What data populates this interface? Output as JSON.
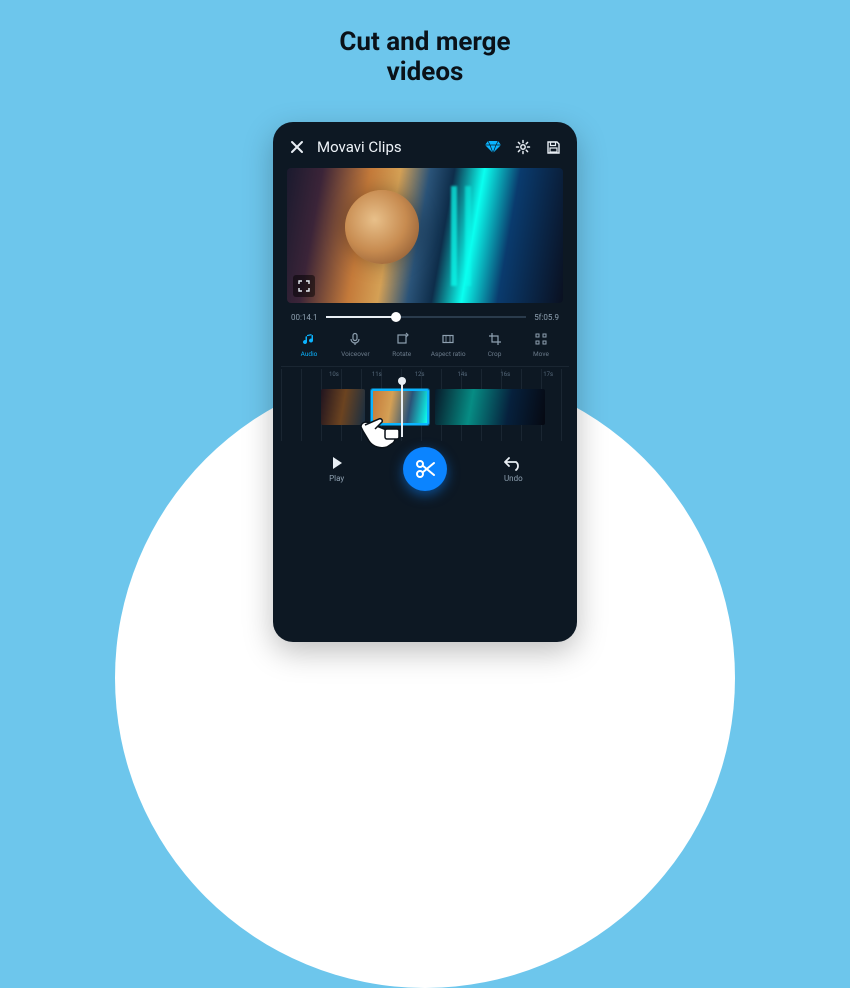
{
  "headline_line1": "Cut and merge",
  "headline_line2": "videos",
  "appbar": {
    "title": "Movavi Clips"
  },
  "time": {
    "current": "00:14.1",
    "total": "5f:05.9"
  },
  "tools": [
    {
      "id": "audio",
      "label": "Audio"
    },
    {
      "id": "voiceover",
      "label": "Voiceover"
    },
    {
      "id": "rotate",
      "label": "Rotate"
    },
    {
      "id": "aspect",
      "label": "Aspect ratio"
    },
    {
      "id": "crop",
      "label": "Crop"
    },
    {
      "id": "move",
      "label": "Move"
    }
  ],
  "ruler_ticks": [
    "10s",
    "11s",
    "12s",
    "14s",
    "16s",
    "17s"
  ],
  "bottombar": {
    "play": "Play",
    "undo": "Undo"
  }
}
